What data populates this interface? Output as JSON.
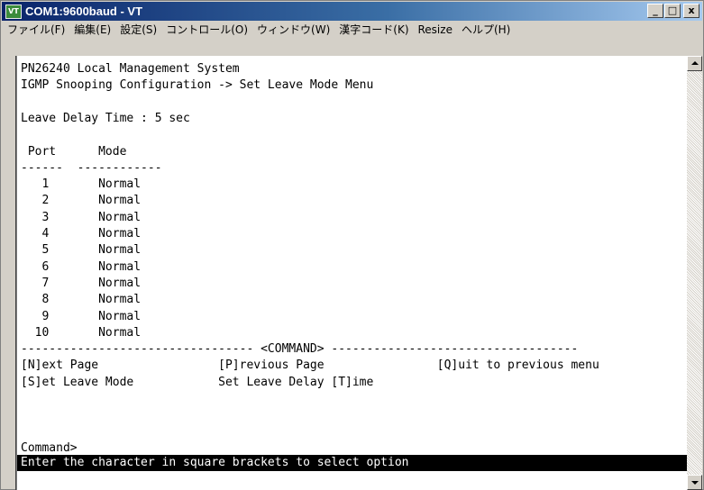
{
  "window": {
    "title": "COM1:9600baud - VT",
    "icon_name": "terminal-app-icon",
    "icon_text": "VT",
    "controls": {
      "minimize": "_",
      "maximize": "□",
      "close": "x"
    }
  },
  "menu": [
    "ファイル(F)",
    "編集(E)",
    "設定(S)",
    "コントロール(O)",
    "ウィンドウ(W)",
    "漢字コード(K)",
    "Resize",
    "ヘルプ(H)"
  ],
  "terminal": {
    "lines": [
      "PN26240 Local Management System",
      "IGMP Snooping Configuration -> Set Leave Mode Menu",
      "",
      "Leave Delay Time : 5 sec",
      "",
      " Port      Mode",
      "------  ------------",
      "   1       Normal",
      "   2       Normal",
      "   3       Normal",
      "   4       Normal",
      "   5       Normal",
      "   6       Normal",
      "   7       Normal",
      "   8       Normal",
      "   9       Normal",
      "  10       Normal",
      "--------------------------------- <COMMAND> -----------------------------------",
      "[N]ext Page                 [P]revious Page                [Q]uit to previous menu",
      "[S]et Leave Mode            Set Leave Delay [T]ime",
      "",
      "",
      "",
      "Command>"
    ],
    "status": "Enter the character in square brackets to select option"
  },
  "colors": {
    "title_gradient_start": "#0a246a",
    "title_gradient_end": "#a6caf0",
    "terminal_bg": "#ffffff",
    "terminal_fg": "#000000",
    "status_bg": "#000000",
    "status_fg": "#ffffff"
  }
}
